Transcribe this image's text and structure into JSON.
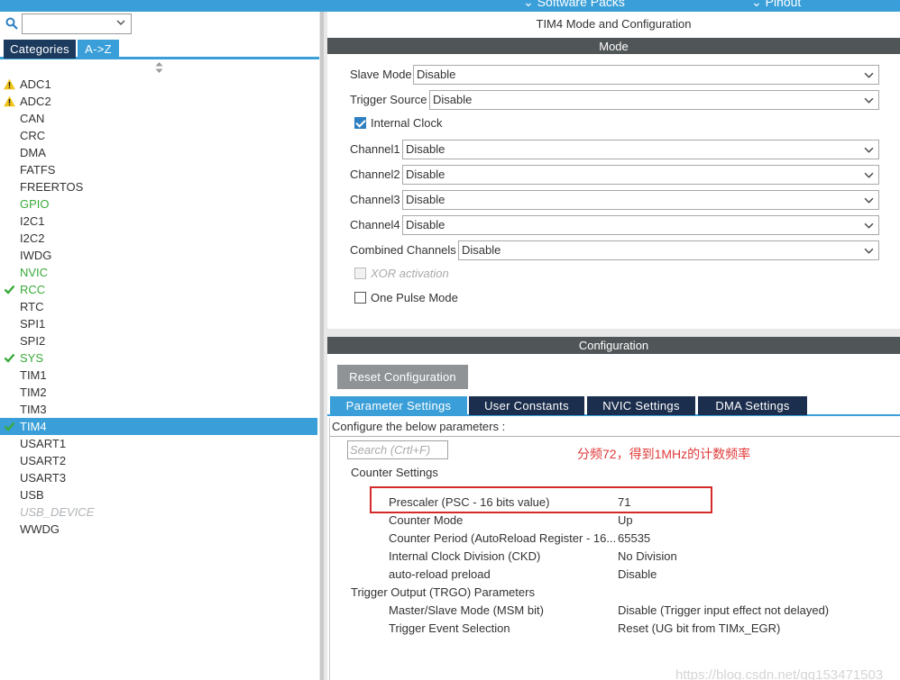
{
  "topbar": {
    "software_packs": "⌄ Software Packs",
    "pinout": "⌄ Pinout"
  },
  "sidebar": {
    "search_value": "",
    "tabs": [
      "Categories",
      "A->Z"
    ],
    "items": [
      {
        "label": "ADC1",
        "status": "warning"
      },
      {
        "label": "ADC2",
        "status": "warning"
      },
      {
        "label": "CAN",
        "status": "none"
      },
      {
        "label": "CRC",
        "status": "none"
      },
      {
        "label": "DMA",
        "status": "none"
      },
      {
        "label": "FATFS",
        "status": "none"
      },
      {
        "label": "FREERTOS",
        "status": "none"
      },
      {
        "label": "GPIO",
        "status": "green"
      },
      {
        "label": "I2C1",
        "status": "none"
      },
      {
        "label": "I2C2",
        "status": "none"
      },
      {
        "label": "IWDG",
        "status": "none"
      },
      {
        "label": "NVIC",
        "status": "green"
      },
      {
        "label": "RCC",
        "status": "check"
      },
      {
        "label": "RTC",
        "status": "none"
      },
      {
        "label": "SPI1",
        "status": "none"
      },
      {
        "label": "SPI2",
        "status": "none"
      },
      {
        "label": "SYS",
        "status": "check"
      },
      {
        "label": "TIM1",
        "status": "none"
      },
      {
        "label": "TIM2",
        "status": "none"
      },
      {
        "label": "TIM3",
        "status": "none"
      },
      {
        "label": "TIM4",
        "status": "selected"
      },
      {
        "label": "USART1",
        "status": "none"
      },
      {
        "label": "USART2",
        "status": "none"
      },
      {
        "label": "USART3",
        "status": "none"
      },
      {
        "label": "USB",
        "status": "none"
      },
      {
        "label": "USB_DEVICE",
        "status": "disabled"
      },
      {
        "label": "WWDG",
        "status": "none"
      }
    ]
  },
  "main": {
    "title": "TIM4 Mode and Configuration",
    "mode_header": "Mode",
    "mode": {
      "slave_mode": {
        "label": "Slave Mode",
        "value": "Disable"
      },
      "trigger_source": {
        "label": "Trigger Source",
        "value": "Disable"
      },
      "internal_clock": {
        "label": "Internal Clock",
        "checked": true
      },
      "channel1": {
        "label": "Channel1",
        "value": "Disable"
      },
      "channel2": {
        "label": "Channel2",
        "value": "Disable"
      },
      "channel3": {
        "label": "Channel3",
        "value": "Disable"
      },
      "channel4": {
        "label": "Channel4",
        "value": "Disable"
      },
      "combined_channels": {
        "label": "Combined Channels",
        "value": "Disable"
      },
      "xor_activation": {
        "label": "XOR activation",
        "checked": false,
        "enabled": false
      },
      "one_pulse_mode": {
        "label": "One Pulse Mode",
        "checked": false
      }
    },
    "config_header": "Configuration",
    "reset_button": "Reset Configuration",
    "tabs": [
      "Parameter Settings",
      "User Constants",
      "NVIC Settings",
      "DMA Settings"
    ],
    "caption": "Configure the below parameters :",
    "search_placeholder": "Search (Crtl+F)",
    "annotation": "分频72，得到1MHz的计数频率",
    "groups": {
      "counter": "Counter Settings",
      "trgo": "Trigger Output (TRGO) Parameters"
    },
    "params": [
      {
        "label": "Prescaler (PSC - 16 bits value)",
        "value": "71"
      },
      {
        "label": "Counter Mode",
        "value": "Up"
      },
      {
        "label": "Counter Period (AutoReload Register - 16...",
        "value": "65535"
      },
      {
        "label": "Internal Clock Division (CKD)",
        "value": "No Division"
      },
      {
        "label": "auto-reload preload",
        "value": "Disable"
      },
      {
        "label": "Master/Slave Mode (MSM bit)",
        "value": "Disable (Trigger input effect not delayed)"
      },
      {
        "label": "Trigger Event Selection",
        "value": "Reset (UG bit from TIMx_EGR)"
      }
    ],
    "watermark": "https://blog.csdn.net/qq153471503"
  },
  "colors": {
    "accent": "#3a9fd8",
    "navy": "#1c3a5e",
    "header_gray": "#505557",
    "ok_green": "#3aaa3a",
    "warning": "#f0c419",
    "annotation_red": "#e03a3a"
  }
}
